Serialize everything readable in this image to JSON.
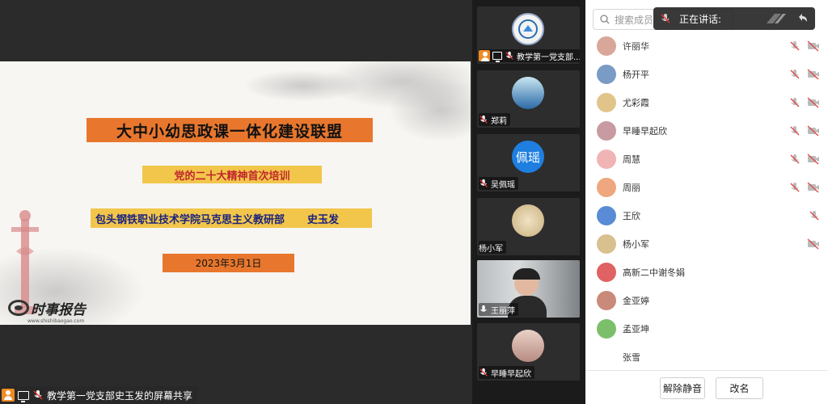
{
  "slide": {
    "title": "大中小幼思政课一体化建设联盟",
    "subtitle": "党的二十大精神首次培训",
    "org": "包头钢铁职业技术学院马克思主义教研部",
    "presenter": "史玉发",
    "date": "2023年3月1日",
    "logo_text": "时事报告",
    "logo_url": "www.shishibaogao.com"
  },
  "share_label": "教学第一党支部史玉发的屏幕共享",
  "video_tiles": [
    {
      "label": "教学第一党支部...",
      "avatar": "emblem",
      "avatar_text": "",
      "color": "#f3f3f3"
    },
    {
      "label": "郑莉",
      "avatar": "photo",
      "avatar_text": "",
      "color": "#6bb7d8"
    },
    {
      "label": "吴佩瑶",
      "avatar": "text",
      "avatar_text": "佩瑶",
      "color": "#1e7fe0"
    },
    {
      "label": "杨小军",
      "avatar": "photo",
      "avatar_text": "",
      "color": "#d8c08f"
    },
    {
      "label": "王丽萍",
      "avatar": "camera",
      "avatar_text": "",
      "color": "#8a8f94"
    },
    {
      "label": "早睡早起欣",
      "avatar": "photo",
      "avatar_text": "",
      "color": "#d4b5a8"
    }
  ],
  "panel": {
    "search_placeholder": "搜索成员",
    "speaking_label": "正在讲话:",
    "members": [
      {
        "name": "许丽华",
        "color": "#d9a79a",
        "mic": "off",
        "video": "off"
      },
      {
        "name": "杨开平",
        "color": "#7a9bc4",
        "mic": "off",
        "video": "off"
      },
      {
        "name": "尤彩霞",
        "color": "#e1c48a",
        "mic": "off",
        "video": "off"
      },
      {
        "name": "早睡早起欣",
        "color": "#c89aa2",
        "mic": "off",
        "video": "off"
      },
      {
        "name": "周慧",
        "color": "#f0b4b4",
        "mic": "off",
        "video": "off"
      },
      {
        "name": "周丽",
        "color": "#eea77e",
        "mic": "off",
        "video": "off"
      },
      {
        "name": "王欣",
        "color": "#5a8bd6",
        "mic": "off",
        "video": "none"
      },
      {
        "name": "杨小军",
        "color": "#d8c08f",
        "mic": "none",
        "video": "off"
      },
      {
        "name": "高新二中谢冬娟",
        "color": "#e06262",
        "mic": "none",
        "video": "none"
      },
      {
        "name": "金亚婷",
        "color": "#c98a7a",
        "mic": "none",
        "video": "none"
      },
      {
        "name": "孟亚坤",
        "color": "#7cbf6b",
        "mic": "none",
        "video": "none"
      },
      {
        "name": "张雪",
        "color": "#ffffff",
        "mic": "none",
        "video": "none"
      }
    ],
    "unmute_all": "解除静音",
    "rename": "改名"
  }
}
